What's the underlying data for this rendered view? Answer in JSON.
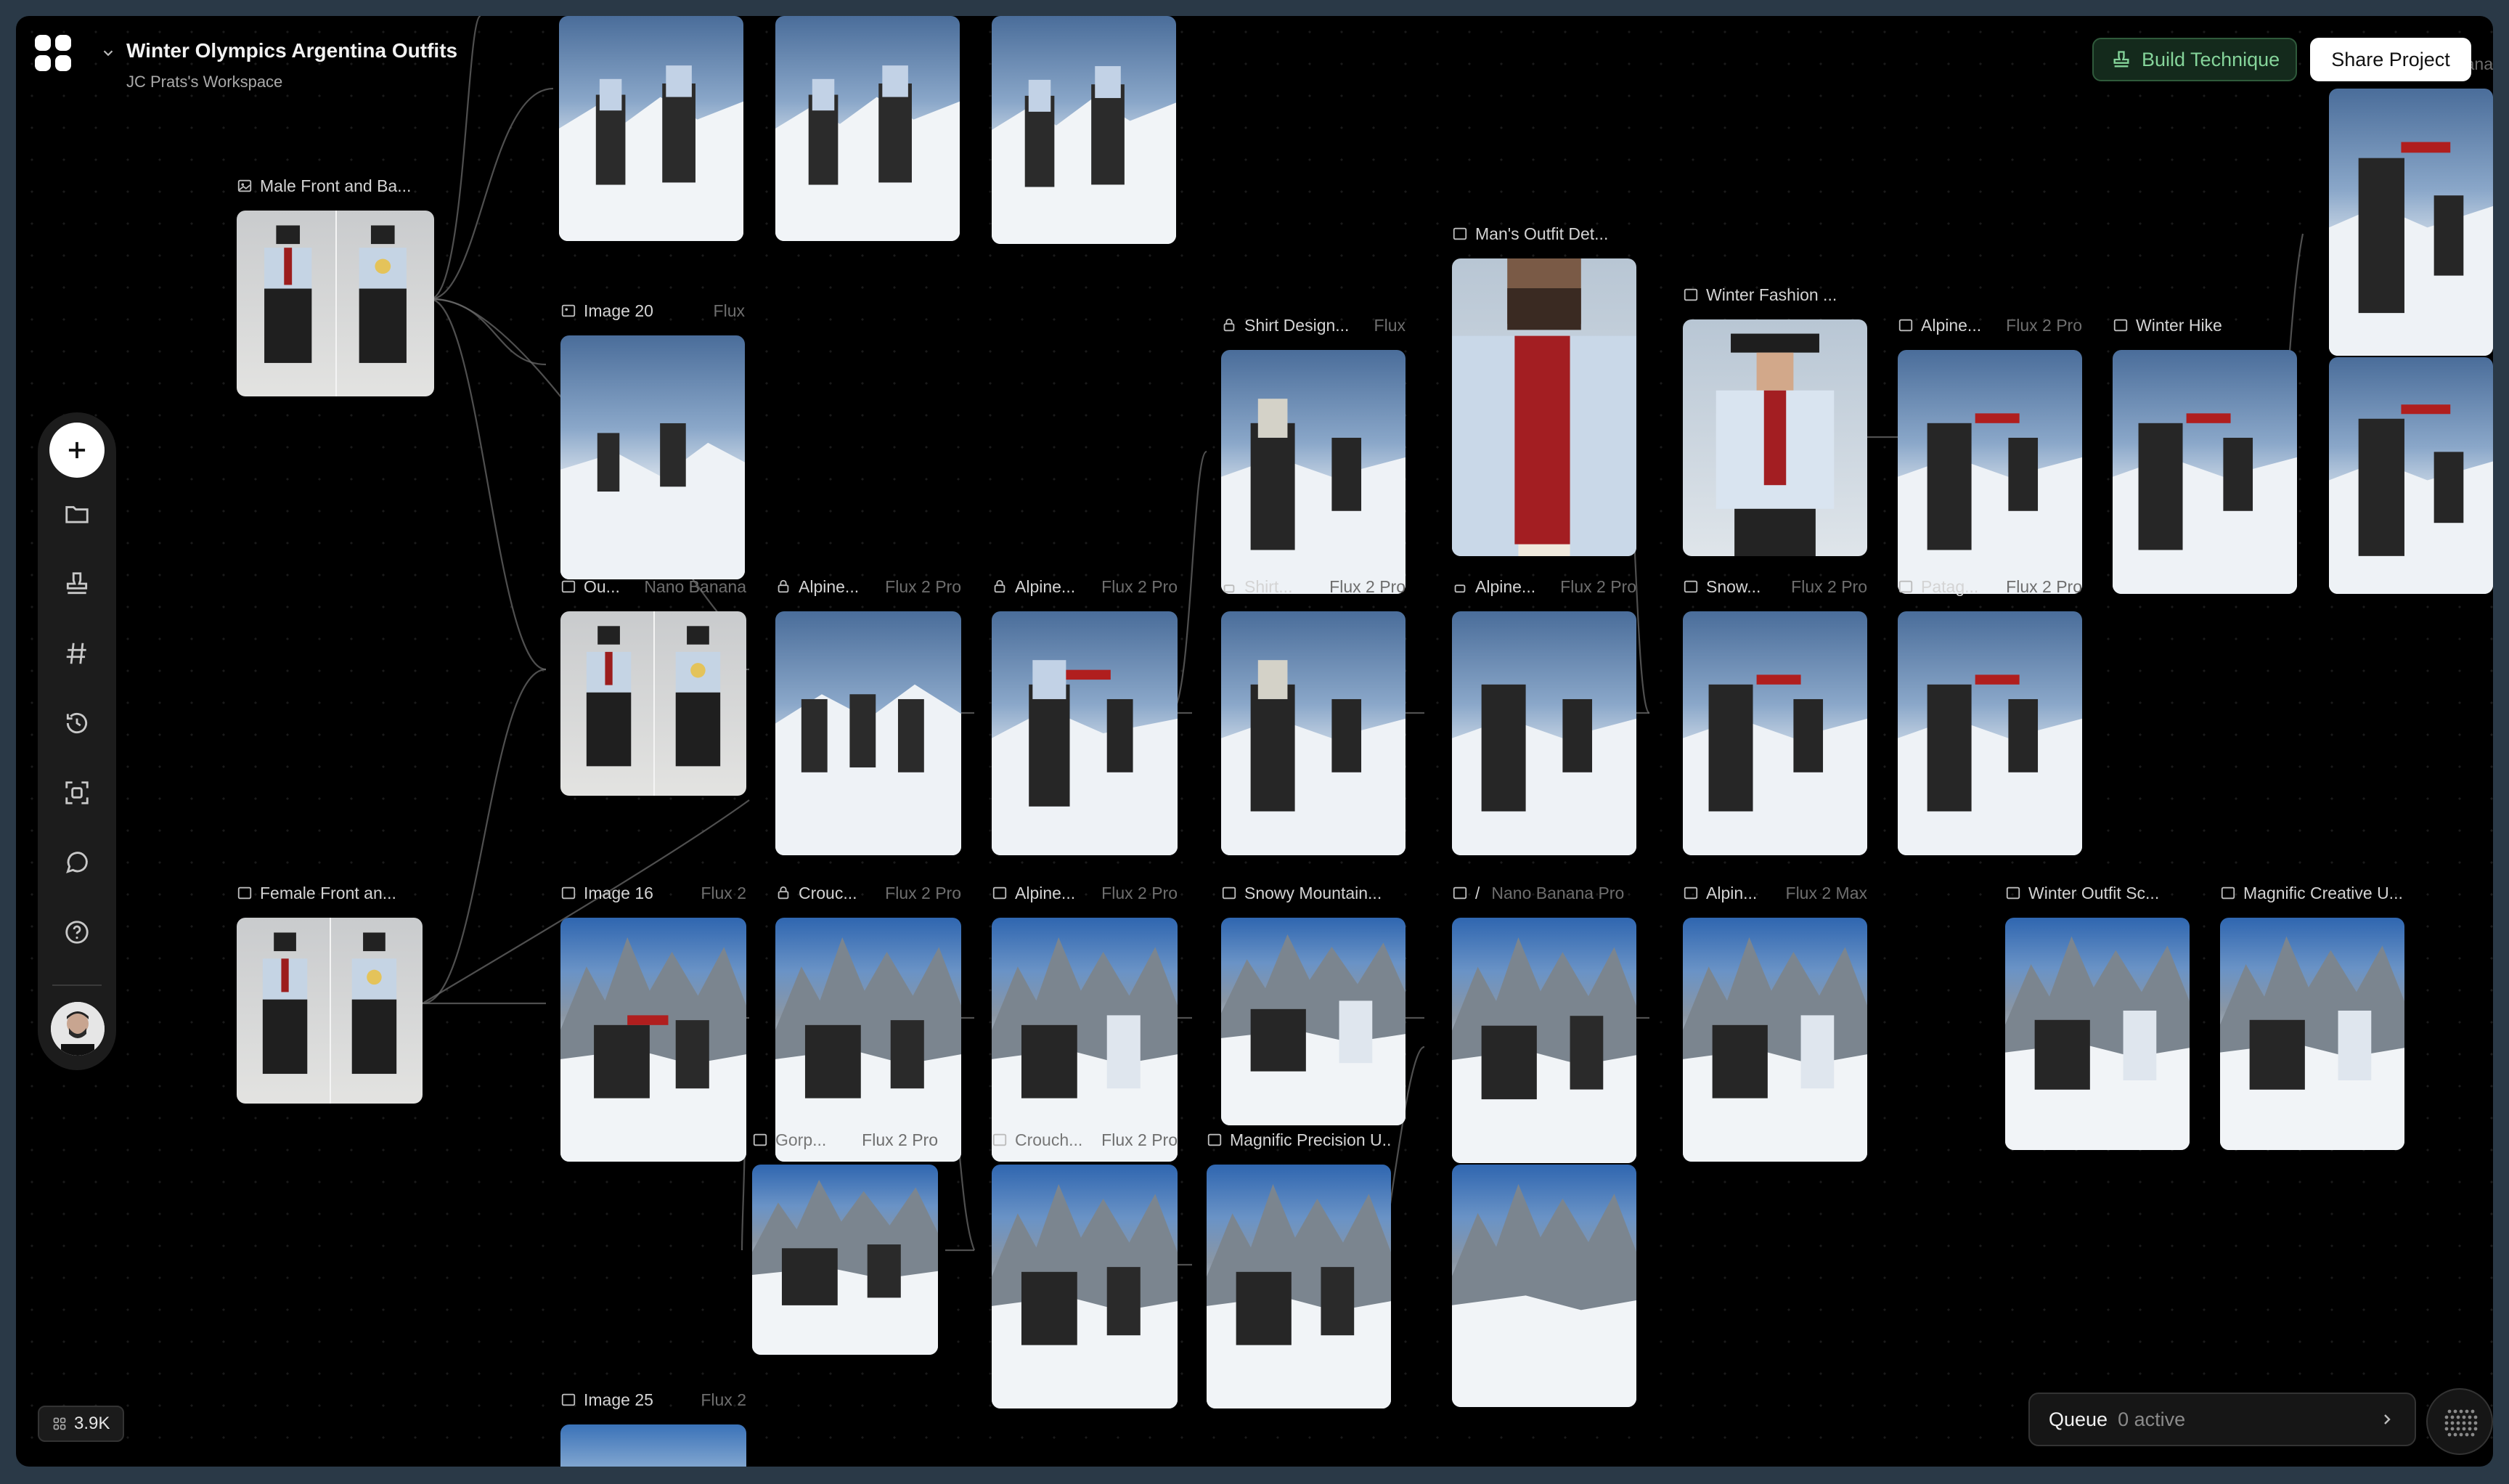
{
  "project": {
    "title": "Winter Olympics Argentina Outfits",
    "workspace": "JC Prats's Workspace"
  },
  "header": {
    "build_label": "Build Technique",
    "share_label": "Share Project"
  },
  "sidebar": {
    "items": [
      "add-icon",
      "folder-icon",
      "stamp-icon",
      "hash-icon",
      "history-icon",
      "scan-face-icon",
      "chat-icon",
      "help-icon"
    ]
  },
  "counter": {
    "value": "3.9K"
  },
  "queue": {
    "label": "Queue",
    "status": "0 active"
  },
  "nodes": [
    {
      "id": "male-front",
      "label": "Male Front and Ba...",
      "model": ""
    },
    {
      "id": "image-20",
      "label": "Image 20",
      "model": "Flux"
    },
    {
      "id": "nano-1",
      "label": "Ou...",
      "model": "Nano Banana"
    },
    {
      "id": "alpine-1",
      "label": "Alpine...",
      "model": "Flux 2 Pro"
    },
    {
      "id": "alpine-2",
      "label": "Alpine...",
      "model": "Flux 2 Pro"
    },
    {
      "id": "shirt-design",
      "label": "Shirt Design...",
      "model": "Flux"
    },
    {
      "id": "shirt-2",
      "label": "Shirt...",
      "model": "Flux 2 Pro"
    },
    {
      "id": "mans-outfit",
      "label": "Man's Outfit Det...",
      "model": ""
    },
    {
      "id": "alpine-3",
      "label": "Alpine...",
      "model": "Flux 2 Pro"
    },
    {
      "id": "winter-fashion",
      "label": "Winter Fashion ...",
      "model": ""
    },
    {
      "id": "snow-1",
      "label": "Snow...",
      "model": "Flux 2 Pro"
    },
    {
      "id": "alpine-4",
      "label": "Alpine...",
      "model": "Flux 2 Pro"
    },
    {
      "id": "patag",
      "label": "Patag...",
      "model": "Flux 2 Pro"
    },
    {
      "id": "winter-hike",
      "label": "Winter Hike",
      "model": ""
    },
    {
      "id": "female-front",
      "label": "Female Front an...",
      "model": ""
    },
    {
      "id": "image-16",
      "label": "Image 16",
      "model": "Flux 2"
    },
    {
      "id": "crouc",
      "label": "Crouc...",
      "model": "Flux 2 Pro"
    },
    {
      "id": "alpine-5",
      "label": "Alpine...",
      "model": "Flux 2 Pro"
    },
    {
      "id": "snowy-mountain",
      "label": "Snowy Mountain...",
      "model": ""
    },
    {
      "id": "nano-2",
      "label": "/",
      "model": "Nano Banana Pro"
    },
    {
      "id": "alpin-6",
      "label": "Alpin...",
      "model": "Flux 2 Max"
    },
    {
      "id": "winter-outfit",
      "label": "Winter Outfit Sc...",
      "model": ""
    },
    {
      "id": "magnific-creative",
      "label": "Magnific Creative U...",
      "model": ""
    },
    {
      "id": "gorp",
      "label": "Gorp...",
      "model": "Flux 2 Pro"
    },
    {
      "id": "crouch-2",
      "label": "Crouch...",
      "model": "Flux 2 Pro"
    },
    {
      "id": "magnific-precision",
      "label": "Magnific Precision U...",
      "model": ""
    },
    {
      "id": "image-25",
      "label": "Image 25",
      "model": "Flux 2"
    },
    {
      "id": "top-right",
      "label": "...ana",
      "model": ""
    }
  ]
}
